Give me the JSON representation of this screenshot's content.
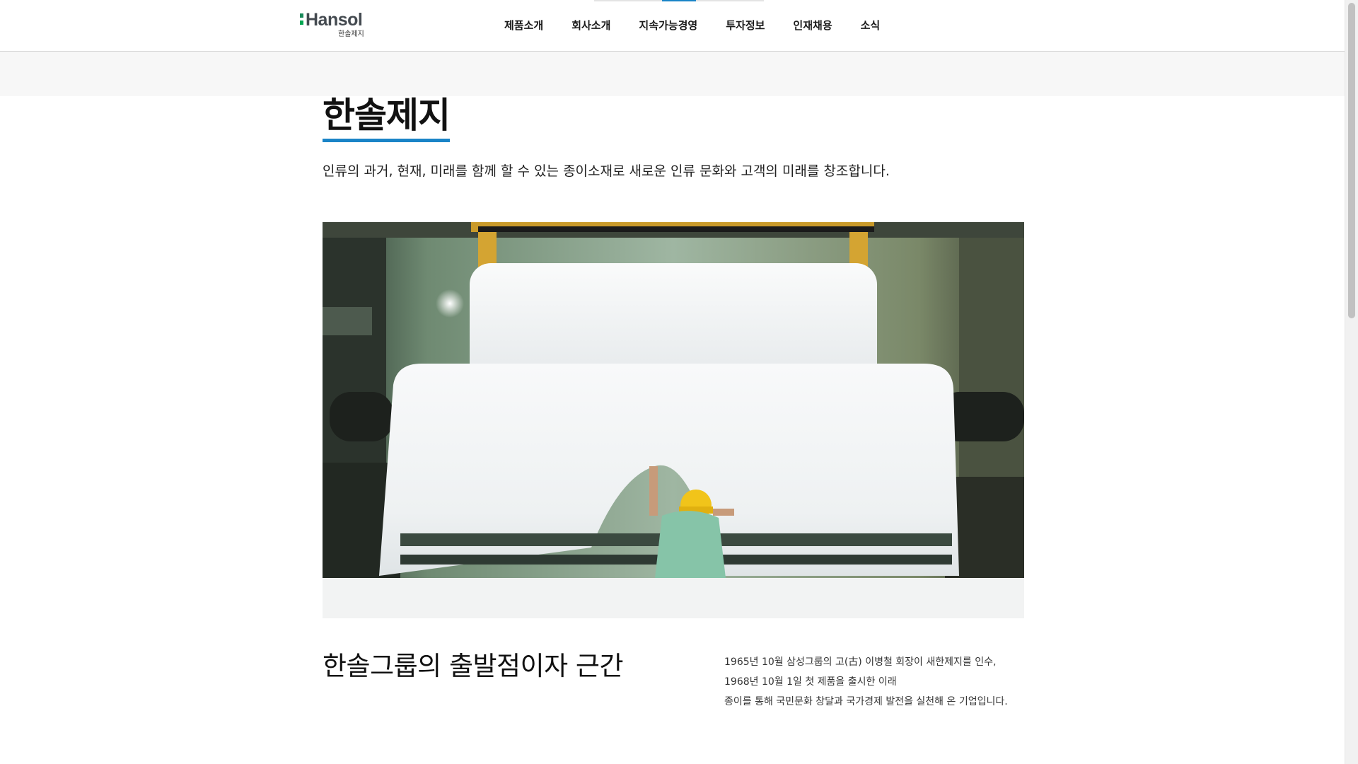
{
  "header": {
    "logo": {
      "wordmark": "Hansol",
      "subtitle": "한솔제지"
    },
    "nav": [
      {
        "label": "제품소개"
      },
      {
        "label": "회사소개"
      },
      {
        "label": "지속가능경영"
      },
      {
        "label": "투자정보"
      },
      {
        "label": "인재채용"
      },
      {
        "label": "소식"
      }
    ]
  },
  "main": {
    "title": "한솔제지",
    "intro": "인류의 과거, 현재, 미래를 함께 할 수 있는 종이소재로 새로운 인류 문화와 고객의 미래를 창조합니다.",
    "hero_image": "paper-mill-worker-image"
  },
  "section": {
    "title": "한솔그룹의 출발점이자 근간",
    "history_lines": [
      "1965년 10월 삼성그룹의 고(古) 이병철 회장이 새한제지를 인수,",
      "1968년 10월 1일 첫 제품을 출시한 이래",
      "종이를 통해 국민문화 창달과 국가경제 발전을 실천해 온 기업입니다."
    ]
  },
  "colors": {
    "accent": "#1a84c7",
    "logo_green": "#00a651",
    "logo_text": "#444a50"
  }
}
